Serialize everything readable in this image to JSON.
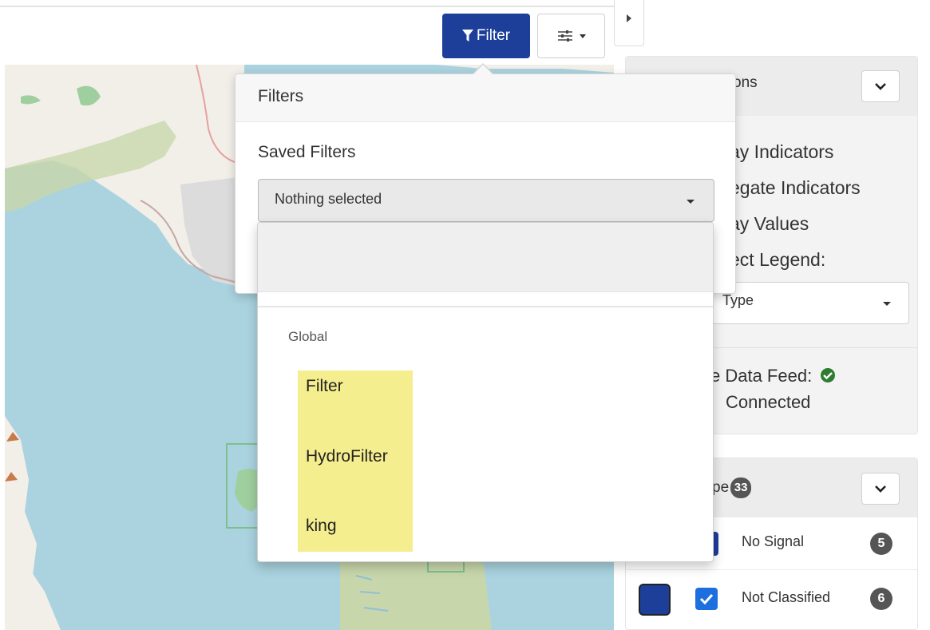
{
  "toolbar": {
    "filter_label": "Filter"
  },
  "sidebar": {
    "options_panel": {
      "title_visible": "ons",
      "display_indicators": "ay Indicators",
      "aggregate_indicators": "egate Indicators",
      "display_values": "ay Values",
      "select_legend": "ect Legend:",
      "legend_value": "Type",
      "live_feed_label": "e Data Feed:",
      "live_feed_status": "Connected"
    },
    "type_panel": {
      "title_visible": "pe",
      "count": "33",
      "rows": [
        {
          "label": "No Signal",
          "count": "5",
          "color": "#1d3f9a",
          "checked": true
        },
        {
          "label": "Not Classified",
          "count": "6",
          "color": "#1d3f9a",
          "checked": true
        }
      ]
    }
  },
  "filters_popover": {
    "title": "Filters",
    "saved_label": "Saved Filters",
    "select_value": "Nothing selected",
    "group_label": "Global",
    "items": [
      "Filter",
      "HydroFilter",
      "king"
    ]
  },
  "colors": {
    "primary": "#1d3f9a",
    "highlight": "#f5ee8e",
    "water": "#aad3df",
    "status_ok": "#2e7d32"
  }
}
